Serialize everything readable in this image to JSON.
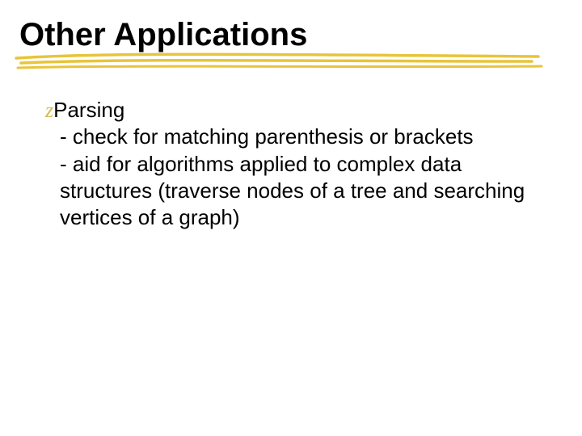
{
  "title": "Other Applications",
  "bullet": {
    "glyph": "z",
    "head": "Parsing",
    "line1": "- check for matching parenthesis or brackets",
    "line2": "- aid for algorithms applied to complex data structures (traverse nodes of a tree and searching vertices of a graph)"
  },
  "colors": {
    "marker": "#e8c43a"
  }
}
